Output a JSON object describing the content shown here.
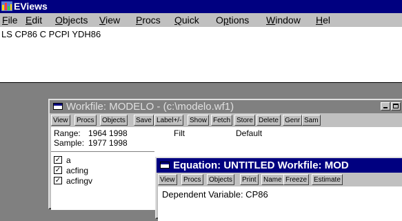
{
  "app": {
    "title": "EViews",
    "menu": [
      {
        "first": "F",
        "rest": "ile"
      },
      {
        "first": "E",
        "rest": "dit"
      },
      {
        "first": "O",
        "rest": "bjects"
      },
      {
        "first": "V",
        "rest": "iew"
      },
      {
        "first": "P",
        "rest": "rocs"
      },
      {
        "first": "Q",
        "rest": "uick"
      },
      {
        "prefix": "O",
        "first": "p",
        "rest": "tions"
      },
      {
        "first": "W",
        "rest": "indow"
      },
      {
        "first": "H",
        "rest": "el"
      }
    ],
    "command": "LS CP86 C PCPI YDH86"
  },
  "workfile": {
    "title": "Workfile: MODELO - (c:\\modelo.wf1)",
    "toolbar": [
      "View",
      "Procs",
      "Objects",
      "Save",
      "Label+/-",
      "Show",
      "Fetch",
      "Store",
      "Delete",
      "Genr",
      "Sam"
    ],
    "range_label": "Range:",
    "range_value": "1964 1998",
    "sample_label": "Sample:",
    "sample_value": "1977 1998",
    "filter_fragment": "Filt",
    "default_fragment": "Default",
    "objects": [
      "a",
      "acfing",
      "acfingv"
    ]
  },
  "equation": {
    "title": "Equation: UNTITLED   Workfile: MOD",
    "toolbar": [
      "View",
      "Procs",
      "Objects",
      "Print",
      "Name",
      "Freeze",
      "Estimate"
    ],
    "dependent": "Dependent Variable: CP86"
  },
  "colors": {
    "active_title": "#000080",
    "inactive_title": "#808080",
    "face": "#c0c0c0"
  }
}
